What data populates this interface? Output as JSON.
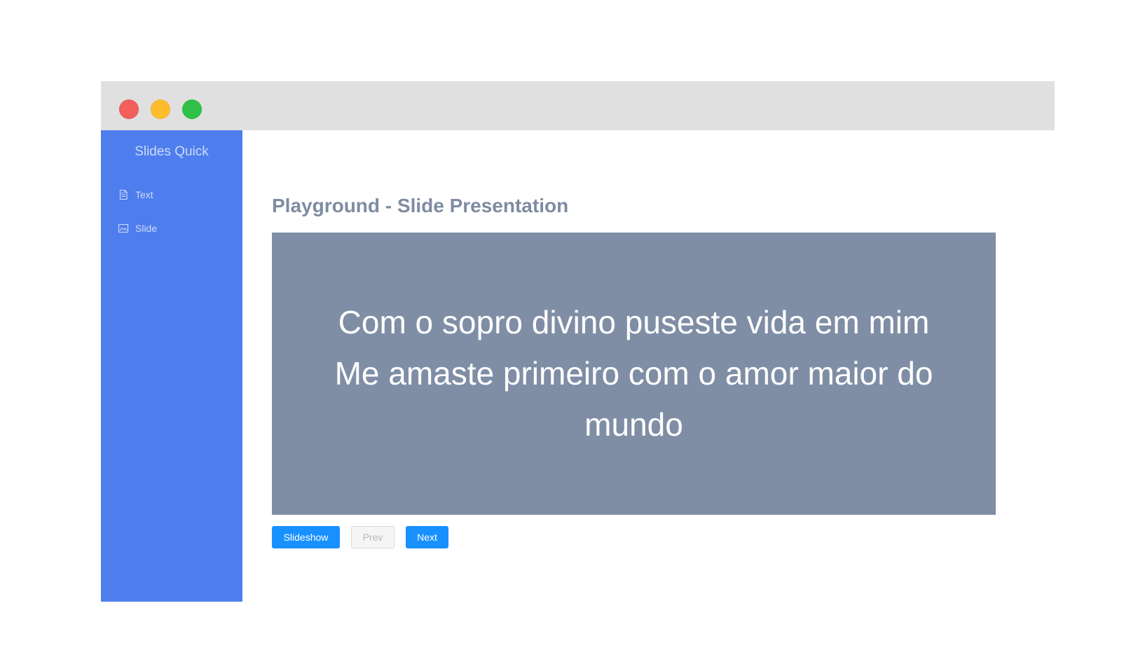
{
  "colors": {
    "titlebar": "#e0e0e0",
    "close_button": "#f25f5c",
    "minimize_button": "#ffbd2e",
    "maximize_button": "#2fc14a",
    "sidebar_background": "#4e7ded",
    "page_title": "#7e8ca2",
    "slide_background": "#7f8ea5",
    "primary_button": "#1890ff"
  },
  "sidebar": {
    "title": "Slides Quick",
    "items": [
      {
        "label": "Text",
        "icon": "file-text-icon"
      },
      {
        "label": "Slide",
        "icon": "image-icon"
      }
    ]
  },
  "main": {
    "title": "Playground - Slide Presentation",
    "slide": {
      "text": "Com o sopro divino puseste vida em mim\nMe amaste primeiro com o amor maior do mundo"
    },
    "buttons": {
      "slideshow": "Slideshow",
      "prev": "Prev",
      "next": "Next"
    }
  }
}
